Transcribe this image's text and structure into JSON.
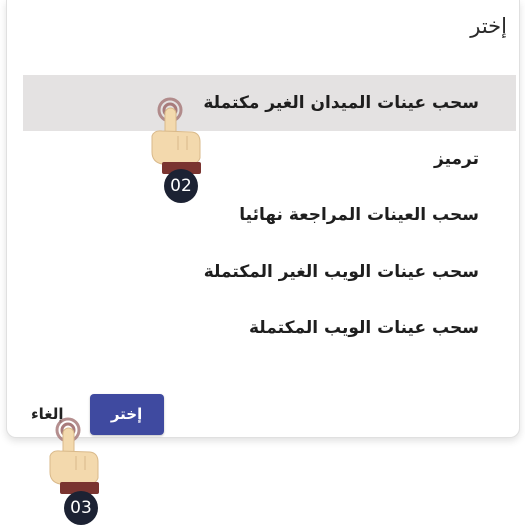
{
  "dialog": {
    "title": "إختر",
    "options": [
      {
        "label": "سحب عينات الميدان الغير مكتملة",
        "selected": true
      },
      {
        "label": "ترميز",
        "selected": false
      },
      {
        "label": "سحب العينات المراجعة نهائيا",
        "selected": false
      },
      {
        "label": "سحب عينات الويب الغير المكتملة",
        "selected": false
      },
      {
        "label": "سحب عينات الويب المكتملة",
        "selected": false
      }
    ],
    "confirm_label": "إختر",
    "cancel_label": "إلغاء"
  },
  "annotations": {
    "step_select_option": "02",
    "step_confirm": "03"
  },
  "colors": {
    "primary_button": "#3f4aa0",
    "selected_row": "#e4e2e2",
    "badge": "#1c2233",
    "hand_skin": "#f3d9ad",
    "hand_cuff": "#7a3430"
  }
}
